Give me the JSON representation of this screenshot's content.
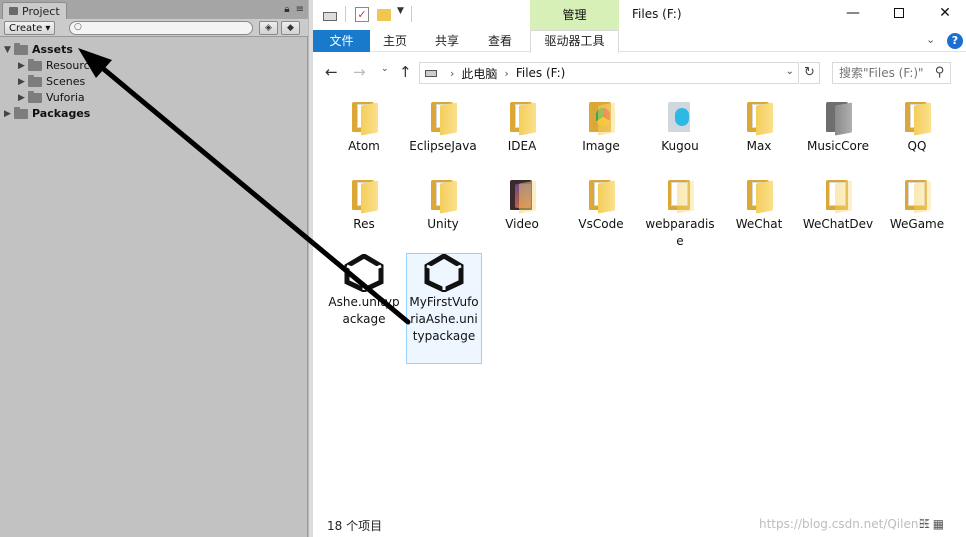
{
  "unity": {
    "tab_label": "Project",
    "create_label": "Create",
    "search_placeholder": "",
    "tree": [
      {
        "label": "Assets",
        "bold": true
      },
      {
        "label": "Resources",
        "bold": false
      },
      {
        "label": "Scenes",
        "bold": false
      },
      {
        "label": "Vuforia",
        "bold": false
      },
      {
        "label": "Packages",
        "bold": true
      }
    ]
  },
  "explorer": {
    "manage_tab": "管理",
    "window_title": "Files (F:)",
    "window_buttons": {
      "minimize": "—",
      "close": "✕"
    },
    "ribbon": {
      "file": "文件",
      "home": "主页",
      "share": "共享",
      "view": "查看",
      "drive_tools": "驱动器工具"
    },
    "address": {
      "root": "此电脑",
      "current": "Files (F:)"
    },
    "search_placeholder": "搜索\"Files (F:)\"",
    "items": [
      {
        "label": "Atom",
        "icon": "folder-icon"
      },
      {
        "label": "EclipseJava",
        "icon": "folder-icon"
      },
      {
        "label": "IDEA",
        "icon": "folder-icon"
      },
      {
        "label": "Image",
        "icon": "folder-chrome-icon"
      },
      {
        "label": "Kugou",
        "icon": "folder-kugou-icon"
      },
      {
        "label": "Max",
        "icon": "folder-icon"
      },
      {
        "label": "MusicCore",
        "icon": "folder-dark-icon"
      },
      {
        "label": "QQ",
        "icon": "folder-icon"
      },
      {
        "label": "Res",
        "icon": "folder-icon"
      },
      {
        "label": "Unity",
        "icon": "folder-icon"
      },
      {
        "label": "Video",
        "icon": "folder-video-icon"
      },
      {
        "label": "VsCode",
        "icon": "folder-icon"
      },
      {
        "label": "webparadise",
        "icon": "folder-docs-icon"
      },
      {
        "label": "WeChat",
        "icon": "folder-icon"
      },
      {
        "label": "WeChatDev",
        "icon": "folder-docs-icon"
      },
      {
        "label": "WeGame",
        "icon": "folder-docs-icon"
      },
      {
        "label": "Ashe.unitypackage",
        "icon": "unity-icon"
      },
      {
        "label": "MyFirstVuforiaAshe.unitypackage",
        "icon": "unity-icon",
        "selected": true
      }
    ],
    "status": {
      "count": "18 个项目",
      "watermark": "https://blog.csdn.net/QileniK"
    }
  },
  "colors": {
    "file_tab": "#1979ca",
    "manage_tab": "#d7f0b8",
    "selection": "#99d1ff",
    "arrow": "#000000"
  }
}
